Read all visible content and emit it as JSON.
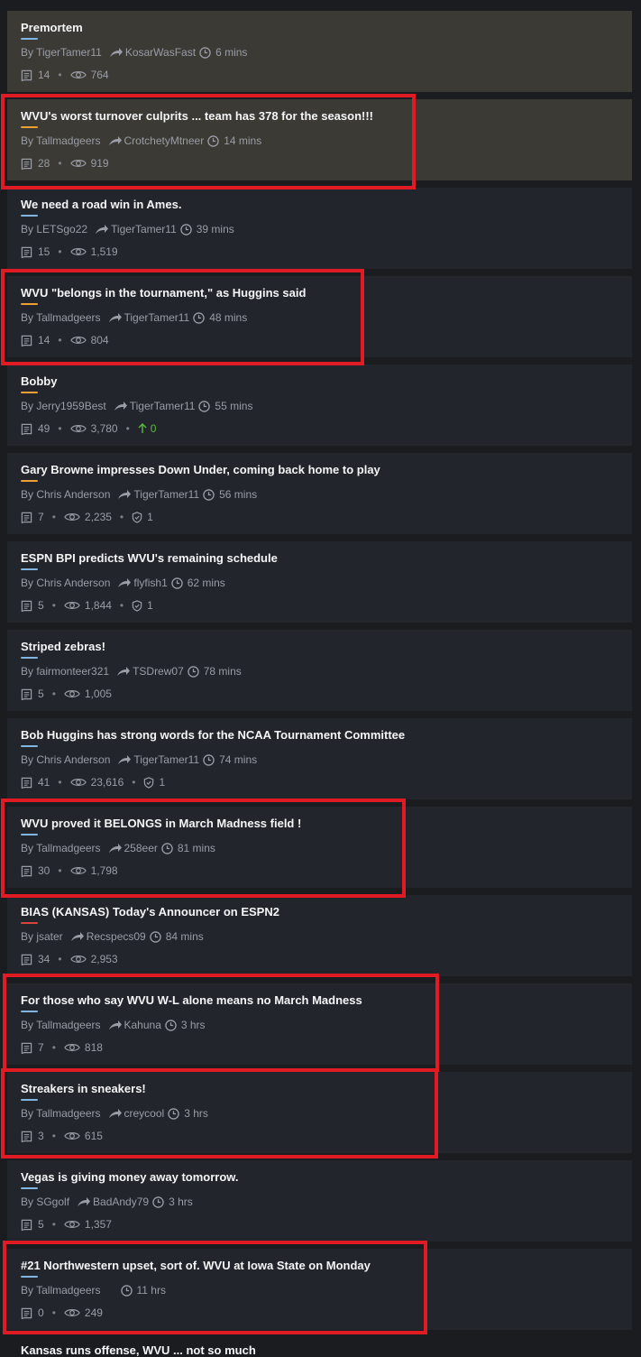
{
  "colors": {
    "background": "#1b1c20",
    "card": "#23252c",
    "card_highlighted": "#3b3a35",
    "highlight_box": "#e11b23",
    "upvote_green": "#5dbb3a"
  },
  "threads": [
    {
      "title": "Premortem",
      "author": "By TigerTamer11",
      "last_reply_by": "KosarWasFast",
      "time": "6 mins",
      "comments": "14",
      "views": "764",
      "underline": "#7fb6e6",
      "highlighted_bg": true
    },
    {
      "title": "WVU's worst turnover culprits ... team has 378 for the season!!!",
      "author": "By Tallmadgeers",
      "last_reply_by": "CrotchetyMtneer",
      "time": "14 mins",
      "comments": "28",
      "views": "919",
      "underline": "#f0a030",
      "highlighted_bg": true
    },
    {
      "title": "We need a road win in Ames.",
      "author": "By LETSgo22",
      "last_reply_by": "TigerTamer11",
      "time": "39 mins",
      "comments": "15",
      "views": "1,519",
      "underline": "#7fb6e6"
    },
    {
      "title": "WVU \"belongs in the tournament,\" as Huggins said",
      "author": "By Tallmadgeers",
      "last_reply_by": "TigerTamer11",
      "time": "48 mins",
      "comments": "14",
      "views": "804",
      "underline": "#f0a030"
    },
    {
      "title": "Bobby",
      "author": "By Jerry1959Best",
      "last_reply_by": "TigerTamer11",
      "time": "55 mins",
      "comments": "49",
      "views": "3,780",
      "upvotes": "0",
      "underline": "#f0a030"
    },
    {
      "title": "Gary Browne impresses Down Under, coming back home to play",
      "author": "By Chris Anderson",
      "last_reply_by": "TigerTamer11",
      "time": "56 mins",
      "comments": "7",
      "views": "2,235",
      "badges": "1",
      "underline": "#f0a030"
    },
    {
      "title": "ESPN BPI predicts WVU's remaining schedule",
      "author": "By Chris Anderson",
      "last_reply_by": "flyfish1",
      "time": "62 mins",
      "comments": "5",
      "views": "1,844",
      "badges": "1",
      "underline": "#7fb6e6"
    },
    {
      "title": "Striped zebras!",
      "author": "By fairmonteer321",
      "last_reply_by": "TSDrew07",
      "time": "78 mins",
      "comments": "5",
      "views": "1,005",
      "underline": "#7fb6e6"
    },
    {
      "title": "Bob Huggins has strong words for the NCAA Tournament Committee",
      "author": "By Chris Anderson",
      "last_reply_by": "TigerTamer11",
      "time": "74 mins",
      "comments": "41",
      "views": "23,616",
      "badges": "1",
      "underline": "#7fb6e6"
    },
    {
      "title": "WVU proved it BELONGS in March Madness field !",
      "author": "By Tallmadgeers",
      "last_reply_by": "258eer",
      "time": "81 mins",
      "comments": "30",
      "views": "1,798",
      "underline": "#7fb6e6"
    },
    {
      "title": "BIAS (KANSAS) Today's Announcer on ESPN2",
      "author": "By jsater",
      "last_reply_by": "Recspecs09",
      "time": "84 mins",
      "comments": "34",
      "views": "2,953",
      "underline": "#d9453b"
    },
    {
      "title": "For those who say WVU W-L alone means no March Madness",
      "author": "By Tallmadgeers",
      "last_reply_by": "Kahuna",
      "time": "3 hrs",
      "comments": "7",
      "views": "818",
      "underline": "#7fb6e6"
    },
    {
      "title": "Streakers in sneakers!",
      "author": "By Tallmadgeers",
      "last_reply_by": "creycool",
      "time": "3 hrs",
      "comments": "3",
      "views": "615",
      "underline": "#7fb6e6"
    },
    {
      "title": "Vegas is giving money away tomorrow.",
      "author": "By SGgolf",
      "last_reply_by": "BadAndy79",
      "time": "3 hrs",
      "comments": "5",
      "views": "1,357",
      "underline": "#7fb6e6"
    },
    {
      "title": "#21 Northwestern upset, sort of. WVU at Iowa State on Monday",
      "author": "By Tallmadgeers",
      "last_reply_by": "",
      "time": "11 hrs",
      "comments": "0",
      "views": "249",
      "underline": "#7fb6e6"
    }
  ],
  "partial_next_title": "Kansas runs offense, WVU ... not so much"
}
